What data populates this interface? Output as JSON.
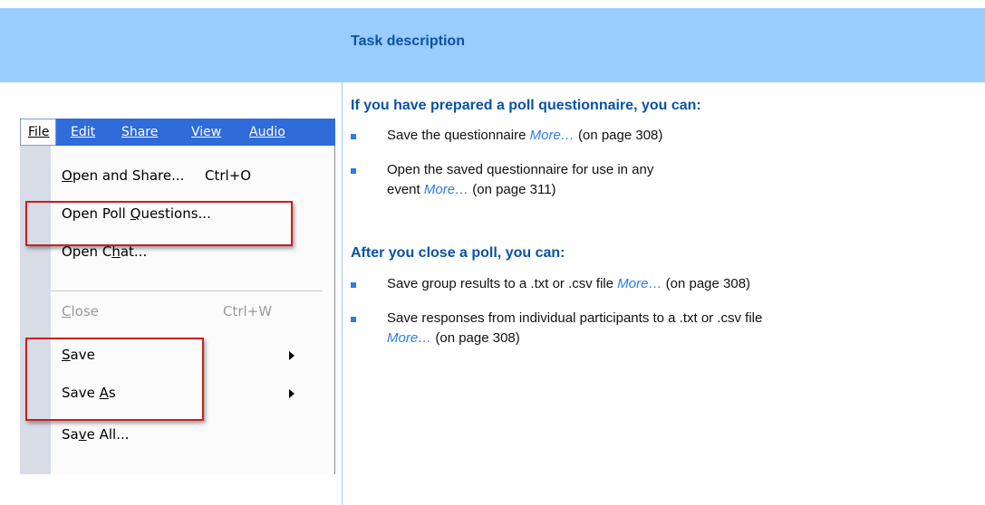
{
  "header": {
    "title": "Task description"
  },
  "menu": {
    "menubar": [
      "File",
      "Edit",
      "Share",
      "View",
      "Audio"
    ],
    "items": [
      {
        "label_pre": "",
        "label_u": "O",
        "label_post": "pen and Share...",
        "shortcut": "Ctrl+O",
        "disabled": false,
        "submenu": false
      },
      {
        "label_pre": "Open Poll ",
        "label_u": "Q",
        "label_post": "uestions...",
        "shortcut": "",
        "disabled": false,
        "submenu": false
      },
      {
        "label_pre": "Open C",
        "label_u": "h",
        "label_post": "at...",
        "shortcut": "",
        "disabled": false,
        "submenu": false
      },
      {
        "label_pre": "",
        "label_u": "C",
        "label_post": "lose",
        "shortcut": "Ctrl+W",
        "disabled": true,
        "submenu": false
      },
      {
        "label_pre": "",
        "label_u": "S",
        "label_post": "ave",
        "shortcut": "",
        "disabled": false,
        "submenu": true
      },
      {
        "label_pre": "Save ",
        "label_u": "A",
        "label_post": "s",
        "shortcut": "",
        "disabled": false,
        "submenu": true
      },
      {
        "label_pre": "Sa",
        "label_u": "v",
        "label_post": "e All...",
        "shortcut": "",
        "disabled": false,
        "submenu": false
      }
    ]
  },
  "content": {
    "section1": {
      "heading": "If you have prepared a poll questionnaire, you can:",
      "bullets": [
        {
          "text": "Save the questionnaire ",
          "link": "More…",
          "suffix": " (on page 308)"
        },
        {
          "text": "Open the saved questionnaire for use in any event ",
          "link": "More…",
          "suffix": "(on page 311)"
        }
      ]
    },
    "section2": {
      "heading": "After you close a poll, you can:",
      "bullets": [
        {
          "text": "Save group results to a .txt or .csv file ",
          "link": "More…",
          "suffix": " (on page 308)"
        },
        {
          "text": "Save responses from individual participants to a .txt or .csv file ",
          "link": "More…",
          "suffix": " (on page 308)"
        }
      ]
    }
  },
  "colors": {
    "header_band": "#99ccff",
    "heading_blue": "#0a52a6",
    "link_blue": "#2b7de9",
    "highlight_red": "#c6211f",
    "menubar_blue": "#2f6bd9"
  }
}
